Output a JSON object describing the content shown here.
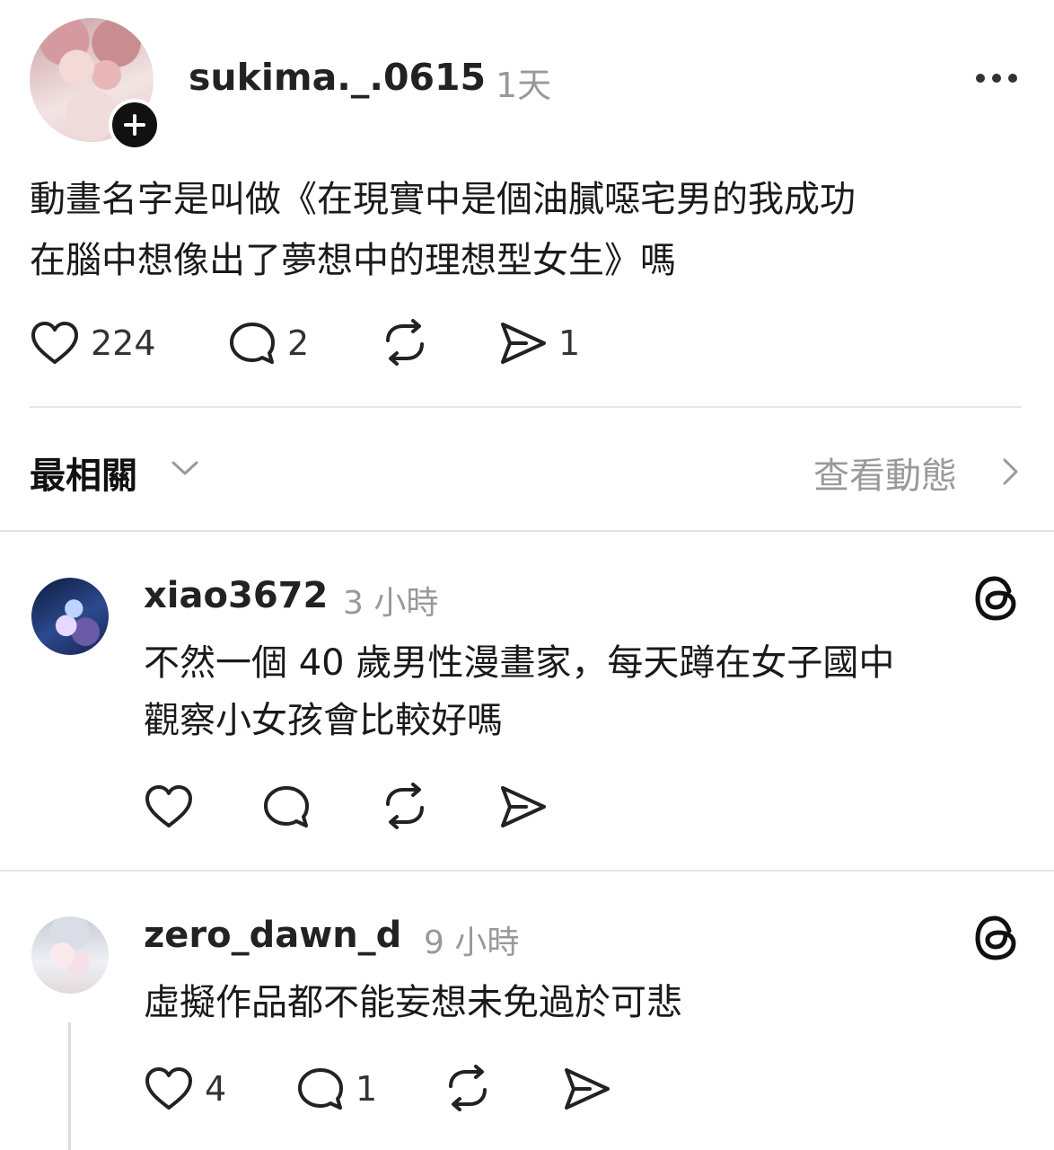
{
  "post": {
    "username": "sukima._.0615",
    "time": "1天",
    "text_lines": [
      "動畫名字是叫做《在現實中是個油膩噁宅男的我成功",
      "在腦中想像出了夢想中的理想型女生》嗎"
    ],
    "likes": "224",
    "replies": "2",
    "shares": "1"
  },
  "sort": {
    "label": "最相關",
    "activity_link": "查看動態"
  },
  "comments": [
    {
      "username": "xiao3672",
      "time": "3 小時",
      "text_lines": [
        "不然一個 40 歲男性漫畫家，每天蹲在女子國中",
        "觀察小女孩會比較好嗎"
      ],
      "likes": "",
      "replies": ""
    },
    {
      "username": "zero_dawn_d",
      "time": "9 小時",
      "text_lines": [
        "虛擬作品都不能妄想未免過於可悲"
      ],
      "likes": "4",
      "replies": "1"
    }
  ],
  "icons": {
    "like": "heart-icon",
    "reply": "comment-icon",
    "repost": "repost-icon",
    "share": "send-icon",
    "more": "more-icon",
    "platform": "threads-icon"
  }
}
